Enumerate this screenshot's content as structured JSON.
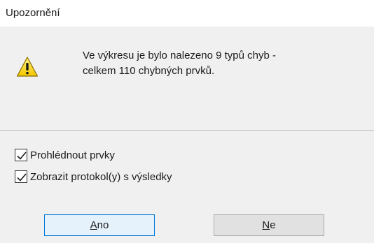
{
  "window": {
    "title": "Upozornění"
  },
  "message": {
    "icon": "warning-icon",
    "line1": "Ve výkresu je bylo nalezeno 9 typů chyb -",
    "line2": "celkem 110 chybných prvků."
  },
  "options": [
    {
      "label": "Prohlédnout prvky",
      "checked": true
    },
    {
      "label": "Zobrazit protokol(y) s výsledky",
      "checked": true
    }
  ],
  "buttons": {
    "yes": {
      "mnemonic": "A",
      "rest": "no"
    },
    "no": {
      "mnemonic": "N",
      "rest": "e"
    }
  },
  "colors": {
    "accent": "#0078d7",
    "panel_bg": "#f0f0f0",
    "warning_yellow": "#f7d40e"
  }
}
